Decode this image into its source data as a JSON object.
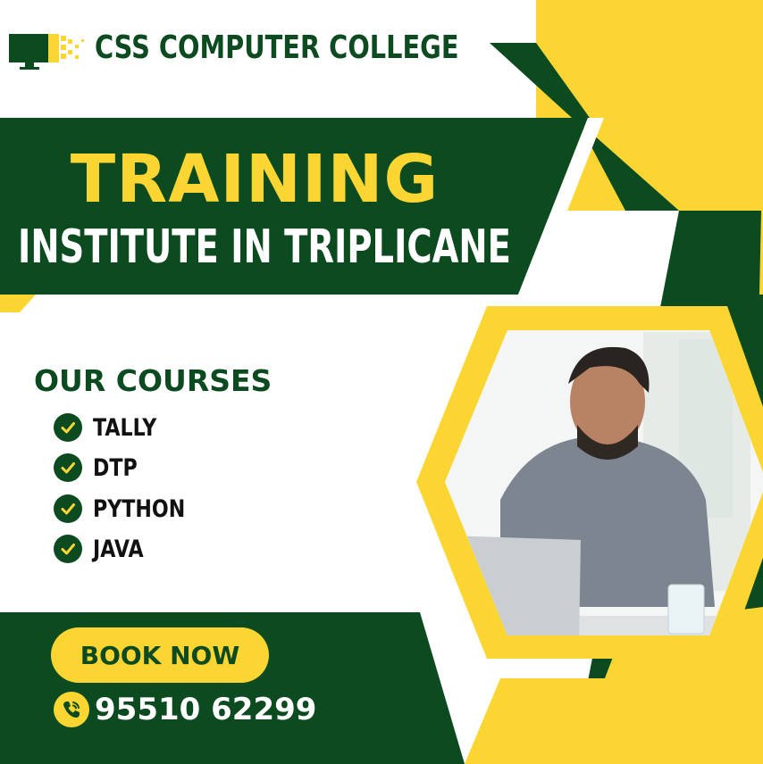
{
  "brand": {
    "name": "CSS COMPUTER COLLEGE",
    "logo_icon": "monitor-pixel-logo"
  },
  "headline": {
    "title": "TRAINING",
    "subtitle": "INSTITUTE IN TRIPLICANE"
  },
  "courses": {
    "title": "OUR COURSES",
    "items": [
      {
        "label": "TALLY",
        "icon": "check-circle-icon"
      },
      {
        "label": "DTP",
        "icon": "check-circle-icon"
      },
      {
        "label": "PYTHON",
        "icon": "check-circle-icon"
      },
      {
        "label": "JAVA",
        "icon": "check-circle-icon"
      }
    ]
  },
  "cta": {
    "book_label": "BOOK NOW",
    "phone": "95510 62299",
    "phone_icon": "phone-call-icon"
  },
  "colors": {
    "green": "#0c4a20",
    "yellow": "#fbd633",
    "white": "#ffffff"
  }
}
